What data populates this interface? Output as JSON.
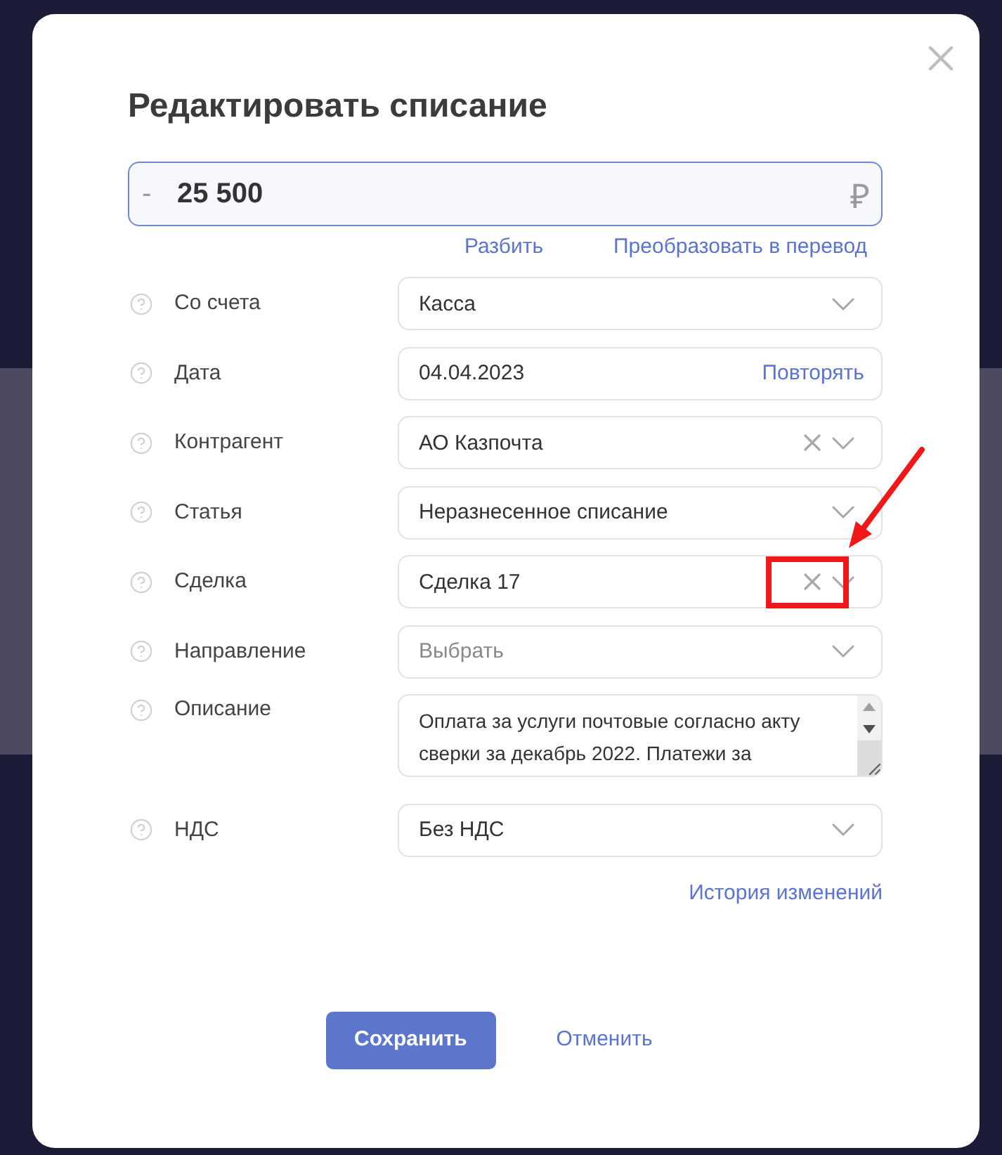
{
  "dialog": {
    "title": "Редактировать списание"
  },
  "amount": {
    "sign": "-",
    "value": "25 500",
    "currency": "₽"
  },
  "amount_links": [
    "Разбить",
    "Преобразовать в перевод"
  ],
  "fields": [
    {
      "kind": "select",
      "label": "Со счета",
      "value": "Касса",
      "clearable": false,
      "highlighted": false
    },
    {
      "kind": "date",
      "label": "Дата",
      "value": "04.04.2023",
      "action": "Повторять",
      "highlighted": false
    },
    {
      "kind": "select",
      "label": "Контрагент",
      "value": "АО Казпочта",
      "clearable": true,
      "highlighted": false
    },
    {
      "kind": "select",
      "label": "Статья",
      "value": "Неразнесенное списание",
      "clearable": false,
      "highlighted": false
    },
    {
      "kind": "select",
      "label": "Сделка",
      "value": "Сделка 17",
      "clearable": true,
      "highlighted": true
    },
    {
      "kind": "select",
      "label": "Направление",
      "placeholder": "Выбрать",
      "clearable": false,
      "highlighted": false
    },
    {
      "kind": "textarea",
      "label": "Описание",
      "value": "Оплата за услуги почтовые согласно акту сверки за декабрь 2022. Платежи за",
      "highlighted": false
    },
    {
      "kind": "select",
      "label": "НДС",
      "value": "Без НДС",
      "clearable": false,
      "highlighted": false
    }
  ],
  "history_link": "История изменений",
  "buttons": [
    {
      "kind": "primary",
      "label": "Сохранить"
    },
    {
      "kind": "link",
      "label": "Отменить"
    }
  ]
}
